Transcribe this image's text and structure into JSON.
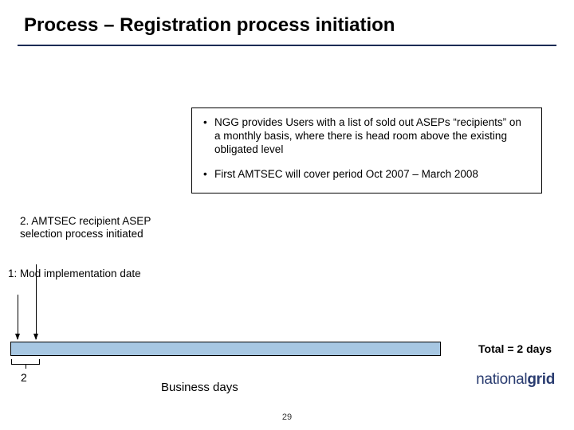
{
  "title": "Process – Registration process initiation",
  "box": {
    "b1": "NGG provides Users with a list of sold out ASEPs “recipients” on a monthly basis, where there is head room above the existing obligated level",
    "b2": "First AMTSEC will cover period Oct 2007 – March 2008"
  },
  "steps": {
    "s2": "2. AMTSEC recipient ASEP selection process initiated",
    "s1": "1: Mod implementation date"
  },
  "total_label": "Total = 2 days",
  "segment_value": "2",
  "xaxis_label": "Business days",
  "logo": "nationalgrid",
  "page_number": "29",
  "chart_data": {
    "type": "bar",
    "orientation": "horizontal",
    "xlabel": "Business days",
    "segments": [
      {
        "from_step": 1,
        "to_step": 2,
        "duration_days": 2
      }
    ],
    "total_days": 2,
    "steps": [
      {
        "id": 1,
        "label": "Mod implementation date",
        "day": 0
      },
      {
        "id": 2,
        "label": "AMTSEC recipient ASEP selection process initiated",
        "day": 2
      }
    ]
  }
}
